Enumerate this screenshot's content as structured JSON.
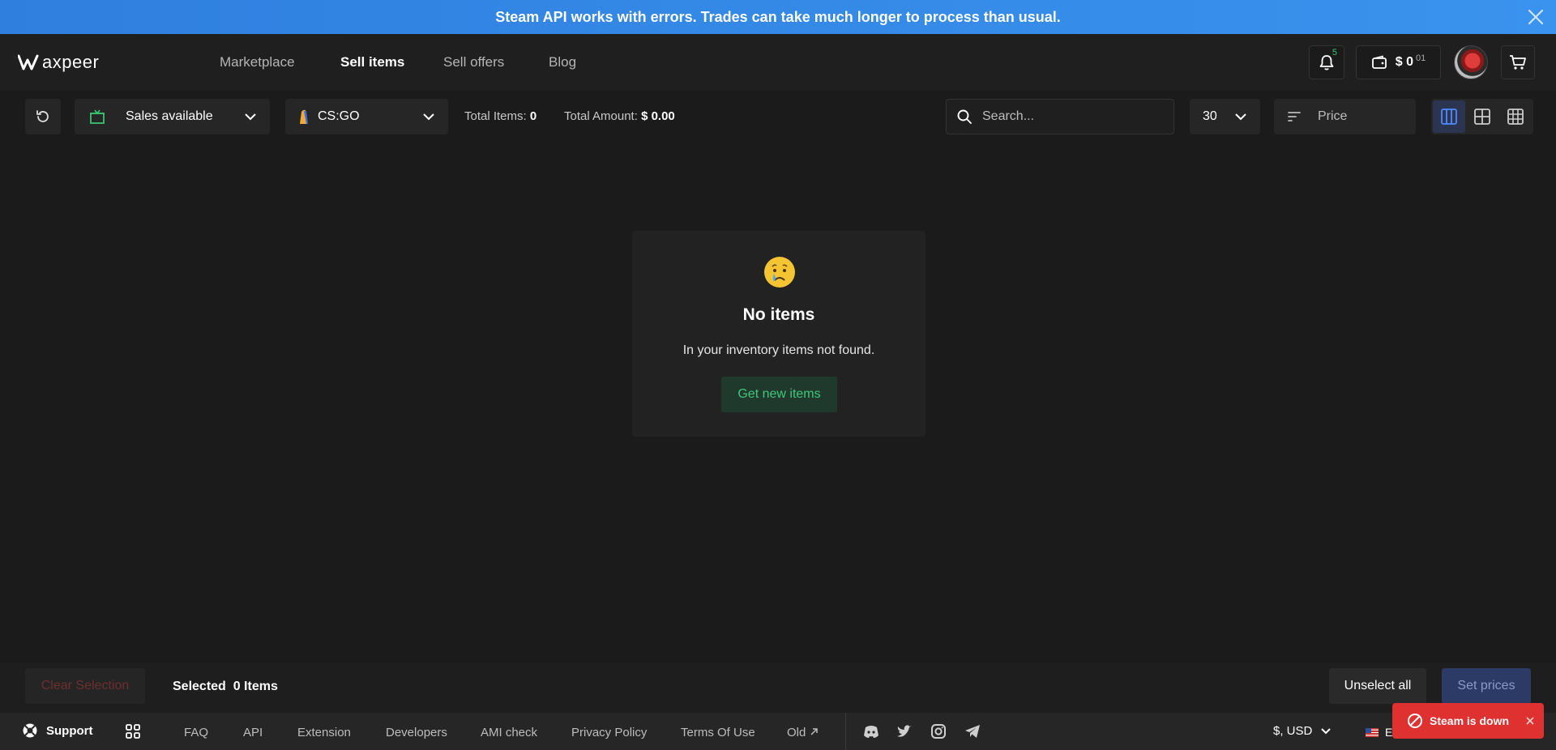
{
  "banner": {
    "message": "Steam API works with errors. Trades can take much longer to process than usual."
  },
  "header": {
    "logo_text": "axpeer",
    "nav": [
      {
        "label": "Marketplace",
        "active": false
      },
      {
        "label": "Sell items",
        "active": true
      },
      {
        "label": "Sell offers",
        "active": false
      },
      {
        "label": "Blog",
        "active": false
      }
    ],
    "notification_count": "5",
    "wallet": {
      "amount": "$ 0",
      "cents": "01"
    }
  },
  "toolbar": {
    "status_filter": "Sales  available",
    "game": "CS:GO",
    "total_items_label": "Total Items:",
    "total_items_value": "0",
    "total_amount_label": "Total Amount:",
    "total_amount_value": "$ 0.00",
    "search_placeholder": "Search...",
    "per_page": "30",
    "sort_label": "Price"
  },
  "empty": {
    "title": "No items",
    "message": "In your inventory items not found.",
    "button": "Get new items"
  },
  "selection": {
    "clear_label": "Clear Selection",
    "selected_label": "Selected",
    "selected_count": "0 Items",
    "unselect_label": "Unselect all",
    "set_prices_label": "Set prices"
  },
  "footer": {
    "support_label": "Support",
    "links": [
      "FAQ",
      "API",
      "Extension",
      "Developers",
      "AMI check",
      "Privacy Policy",
      "Terms Of Use",
      "Old"
    ],
    "currency": "$, USD",
    "language": "EN",
    "theme": "Dark mode"
  },
  "toast": {
    "message": "Steam is down"
  },
  "colors": {
    "accent": "#2f7fdf",
    "success": "#3fc77a",
    "danger": "#e03131"
  }
}
